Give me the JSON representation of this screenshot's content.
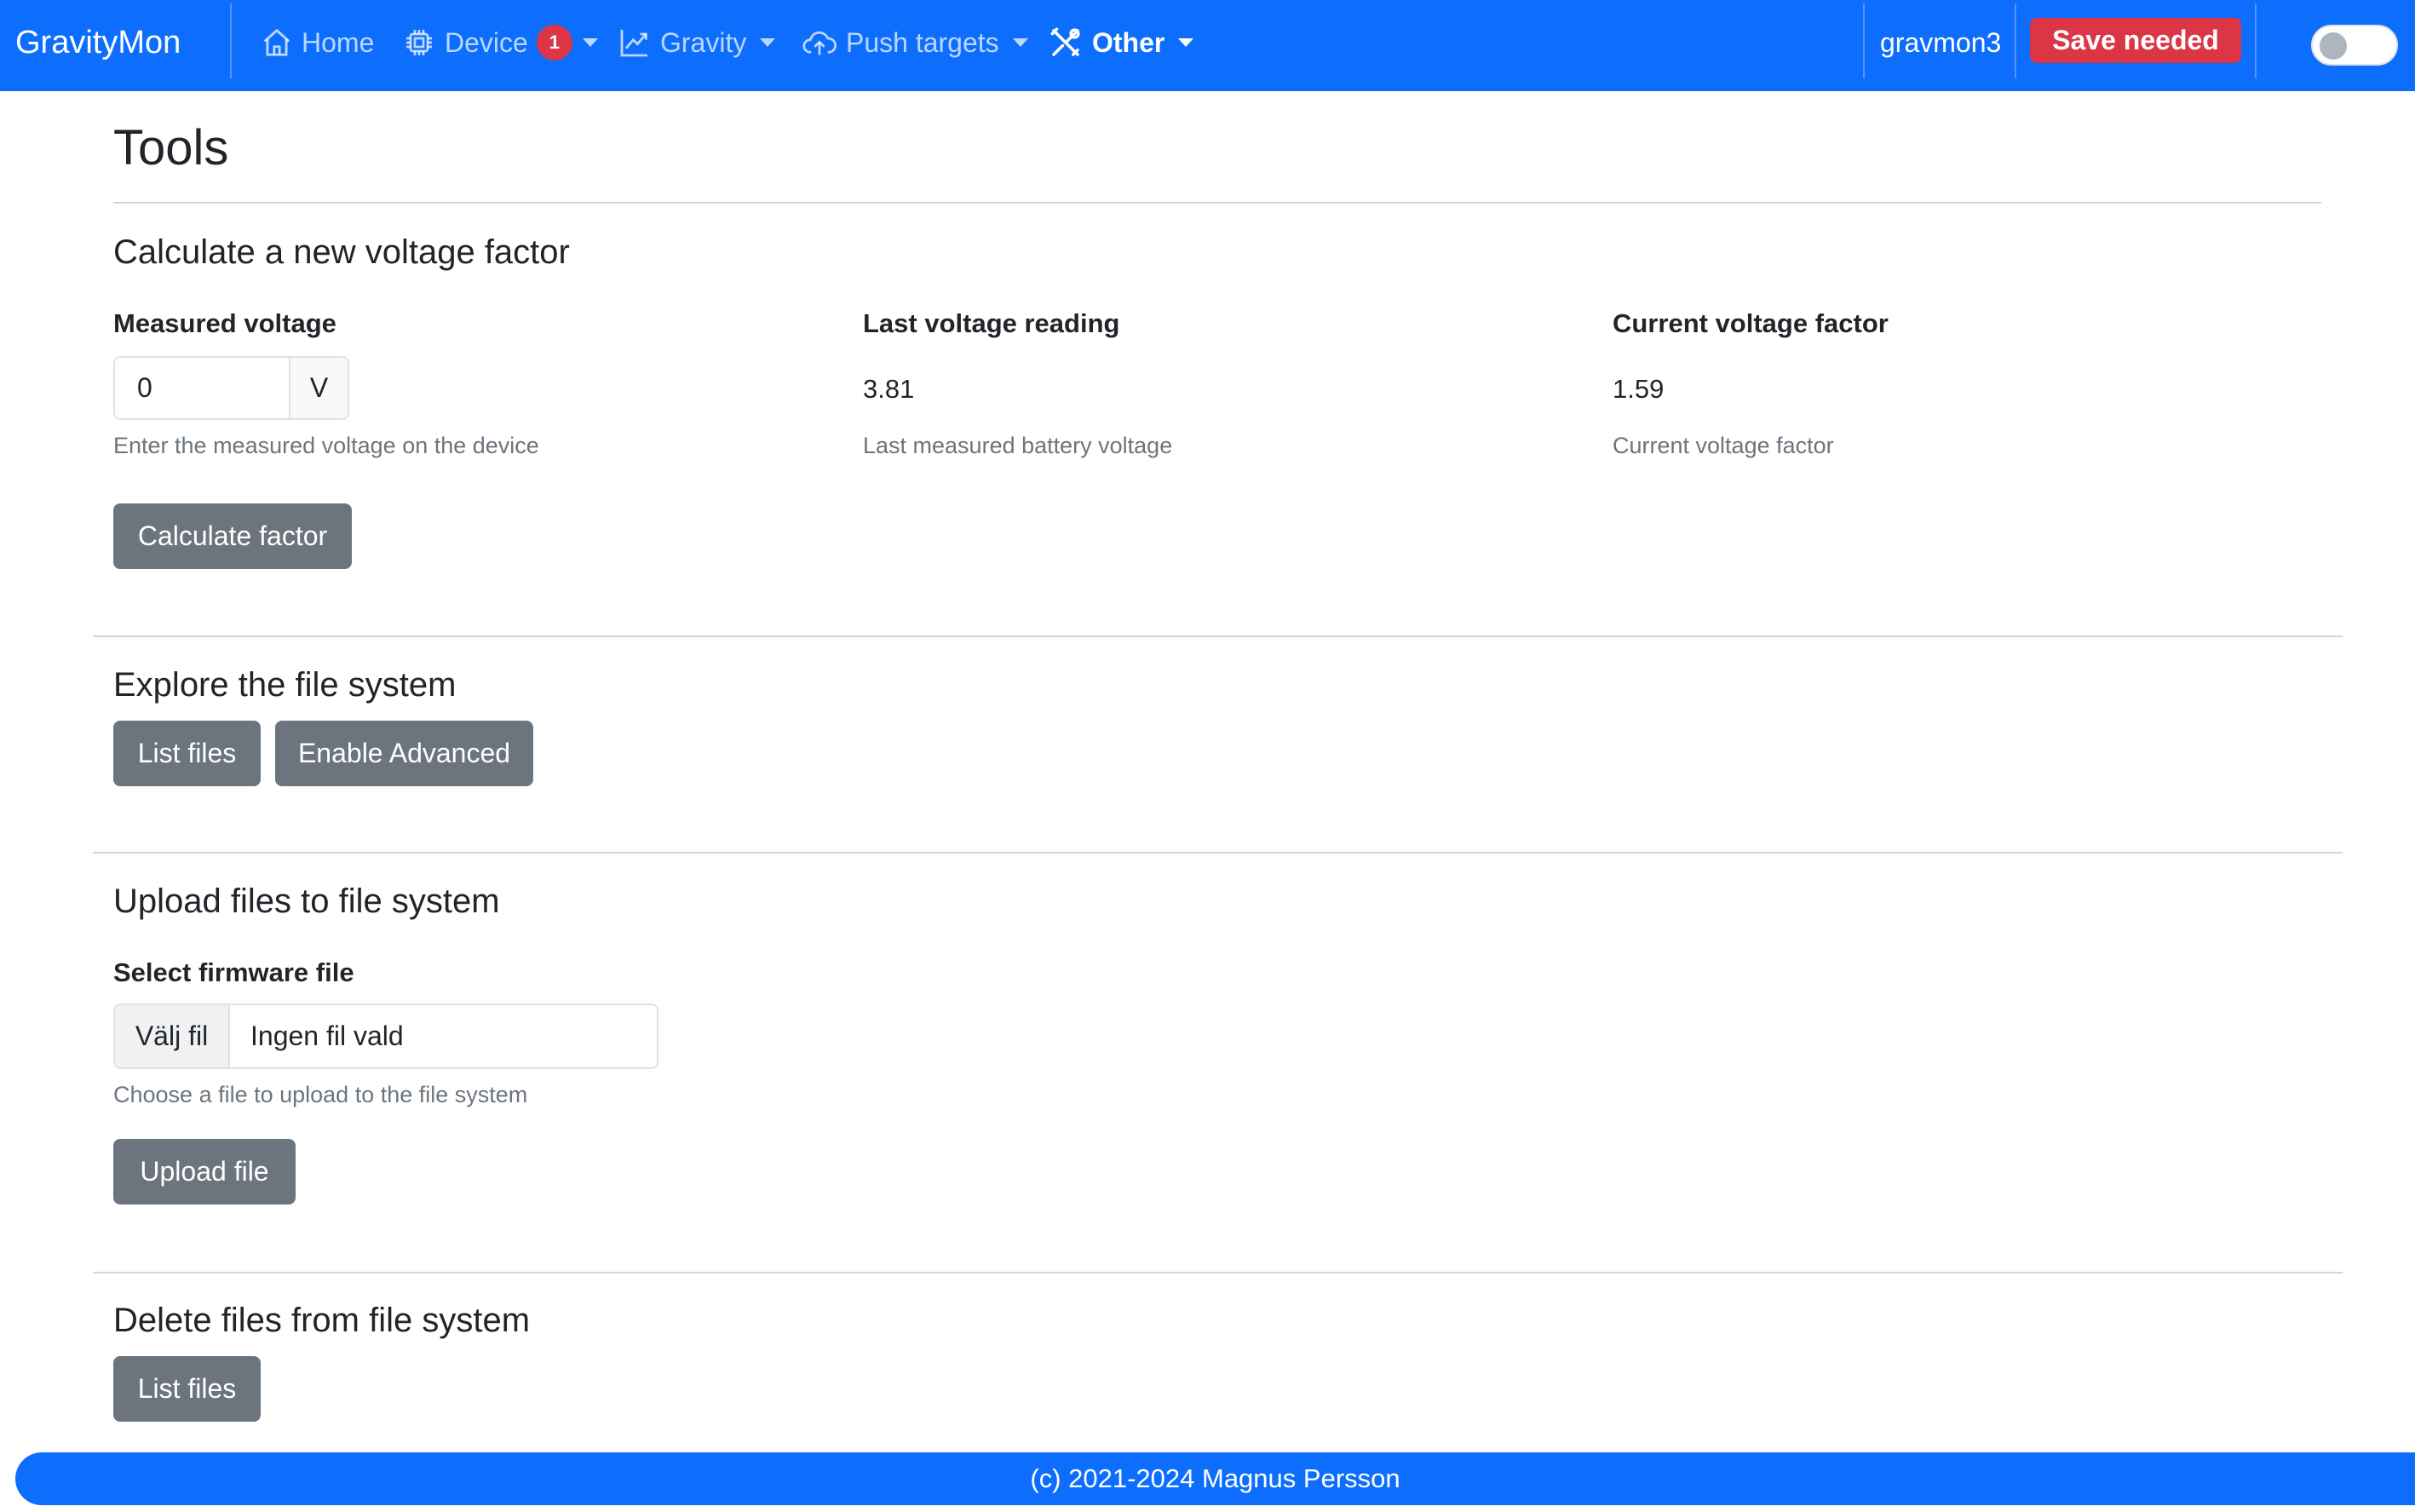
{
  "nav": {
    "brand": "GravityMon",
    "home": "Home",
    "device": "Device",
    "device_badge": "1",
    "gravity": "Gravity",
    "push_targets": "Push targets",
    "other": "Other",
    "hostname": "gravmon3",
    "save_needed": "Save needed",
    "dark_mode_on": false
  },
  "page": {
    "title": "Tools"
  },
  "voltage": {
    "title": "Calculate a new voltage factor",
    "measured_label": "Measured voltage",
    "measured_value": "0",
    "measured_unit": "V",
    "measured_help": "Enter the measured voltage on the device",
    "last_label": "Last voltage reading",
    "last_value": "3.81",
    "last_help": "Last measured battery voltage",
    "factor_label": "Current voltage factor",
    "factor_value": "1.59",
    "factor_help": "Current voltage factor",
    "calculate_button": "Calculate factor"
  },
  "explore": {
    "title": "Explore the file system",
    "list_button": "List files",
    "advanced_button": "Enable Advanced"
  },
  "upload": {
    "title": "Upload files to file system",
    "select_label": "Select firmware file",
    "choose_button": "Välj fil",
    "no_file": "Ingen fil vald",
    "help": "Choose a file to upload to the file system",
    "upload_button": "Upload file"
  },
  "delete": {
    "title": "Delete files from file system",
    "list_button": "List files"
  },
  "footer": {
    "text": "(c) 2021-2024 Magnus Persson"
  },
  "colors": {
    "primary": "#0d6efd",
    "danger": "#dc3545",
    "secondary": "#6c757d"
  }
}
